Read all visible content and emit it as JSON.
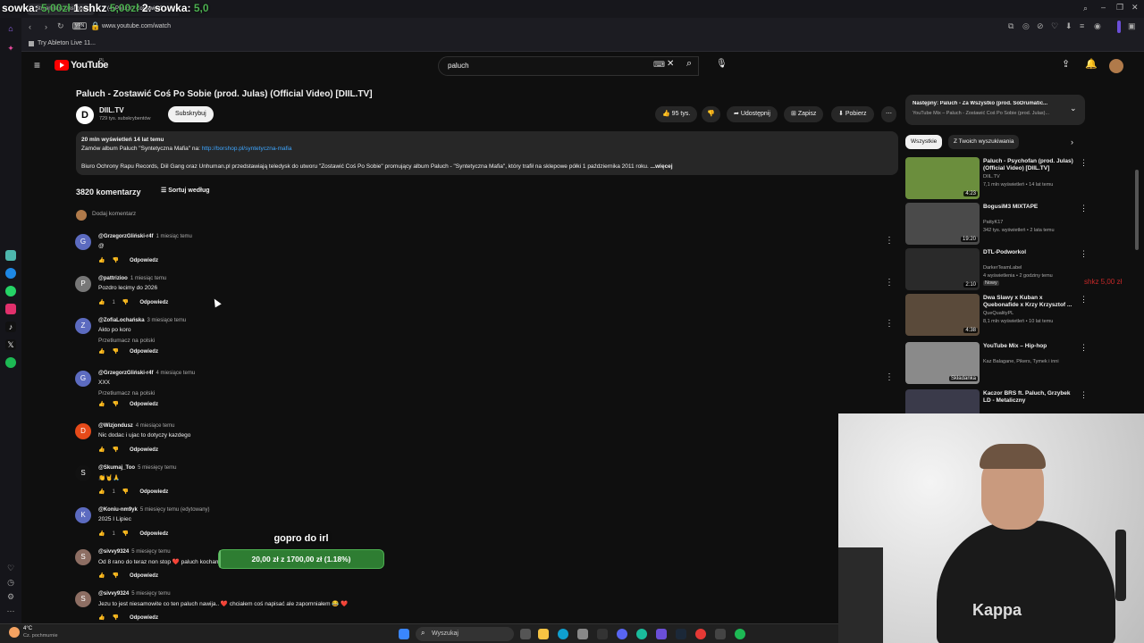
{
  "stream_overlay": {
    "top_text_a": "sowka:",
    "top_val_a": "5,00zł",
    "top_text_b": "1:shkz",
    "top_val_b": "5,00zł",
    "top_text_c": "2: sowka:",
    "top_val_c": "5,0",
    "side_text": "shkz 5,00 zł",
    "goal_title": "gopro do irl",
    "goal_progress": "20,00 zł z 1700,00 zł (1.18%)",
    "goal_fraction": 0.0118
  },
  "browser": {
    "tab_1": "Streamlabs Dashboard",
    "tab_2": "(4) Paluch - Zostawić C...",
    "vpn_badge": "VPN",
    "url": "www.youtube.com/watch",
    "bookmark": "Try Ableton Live 11..."
  },
  "yt": {
    "logo": "YouTube",
    "logo_region": "PL",
    "search_value": "paluch",
    "video_title": "Paluch - Zostawić Coś Po Sobie (prod. Julas) (Official Video) [DIIL.TV]",
    "channel_name": "DIIL.TV",
    "channel_subs": "729 tys. subskrybentów",
    "subscribe_label": "Subskrybuj",
    "likes": "95 tys.",
    "share_label": "Udostępnij",
    "save_label": "Zapisz",
    "download_label": "Pobierz",
    "desc_line1": "20 mln wyświetleń  14 lat temu",
    "desc_line2_prefix": "Zamów album Paluch \"Syntetyczna Mafia\" na: ",
    "desc_link": "http://borshop.pl/syntetyczna-mafia",
    "desc_line3": "Biuro Ochrony Rapu Records, Diil Gang oraz Unhuman.pl przedstawiają teledysk do utworu \"Zostawić Coś Po Sobie\" promujący album Paluch - \"Syntetyczna Mafia\", który trafił na sklepowe półki 1 października 2011 roku.",
    "desc_more": "...więcej",
    "comments_count": "3820 komentarzy",
    "sort_label": "Sortuj według",
    "add_comment": "Dodaj komentarz",
    "reply_label": "Odpowiedz",
    "translate_label": "Przetłumacz na polski",
    "comments": [
      {
        "author": "@GrzegorzGliński-r4f",
        "time": "1 miesiąc temu",
        "text": "@",
        "likes": "",
        "avatar": "G",
        "avatar_color": "#5c6bc0"
      },
      {
        "author": "@pattrizioo",
        "time": "1 miesiąc temu",
        "text": "Pozdro lecimy do 2026",
        "likes": "1",
        "avatar": "P",
        "avatar_color": "#777777"
      },
      {
        "author": "@ZofiaLochańska",
        "time": "3 miesiące temu",
        "text": "Akto po koro",
        "likes": "",
        "avatar": "Z",
        "avatar_color": "#5c6bc0"
      },
      {
        "author": "@GrzegorzGliński-r4f",
        "time": "4 miesiące temu",
        "text": "XXX",
        "likes": "",
        "avatar": "G",
        "avatar_color": "#5c6bc0"
      },
      {
        "author": "@Wizjondusz",
        "time": "4 miesiące temu",
        "text": "Nic dodac i ujac to dotyczy kazdego",
        "likes": "",
        "avatar": "D",
        "avatar_color": "#e64a19"
      },
      {
        "author": "@Skumaj_Too",
        "time": "5 miesięcy temu",
        "text": "👏🤘🙏",
        "likes": "1",
        "avatar": "S",
        "avatar_color": "#111111"
      },
      {
        "author": "@Koniu-nm9yk",
        "time": "5 miesięcy temu (edytowany)",
        "text": "2025 I Lipiec",
        "likes": "1",
        "avatar": "K",
        "avatar_color": "#5c6bc0"
      },
      {
        "author": "@sivvy9324",
        "time": "5 miesięcy temu",
        "text": "Od 8 rano do teraz non stop ❤️ paluch kocham",
        "likes": "",
        "avatar": "S",
        "avatar_color": "#8d6e63"
      },
      {
        "author": "@sivvy9324",
        "time": "5 miesięcy temu",
        "text": "Jezu to jest niesamowite co ten paluch nawija.. ❤️ chciałem coś napisać ale zapomniałem 😂 ❤️",
        "likes": "",
        "avatar": "S",
        "avatar_color": "#8d6e63"
      }
    ],
    "next_label": "Następny: Paluch - Za Wszystko (prod. SoDrumatic...",
    "next_sub": "YouTube Mix – Paluch - Zostawić Coś Po Sobie (prod. Julas)...",
    "chips": [
      "Wszystkie",
      "Z Twoich wyszukiwania"
    ],
    "recs": [
      {
        "title": "Paluch - Psychofan (prod. Julas) (Official Video) [DIIL.TV]",
        "channel": "DIIL.TV",
        "meta": "7,1 mln wyświetleń • 14 lat temu",
        "dur": "4:23",
        "color": "#6b8e3d",
        "badge": ""
      },
      {
        "title": "BogusiM3 MIXTAPE",
        "channel": "PattyK17",
        "meta": "342 tys. wyświetleń • 2 lata temu",
        "dur": "19:20",
        "color": "#4a4a4a",
        "badge": ""
      },
      {
        "title": "DTL-Podworkol",
        "channel": "DarkerTeamLabel",
        "meta": "4 wyświetlenia • 2 godziny temu",
        "dur": "2:10",
        "color": "#2a2a2a",
        "badge": "Nowy"
      },
      {
        "title": "Dwa Slawy x Kuban x Quebonafide x Krzy Krzysztof ...",
        "channel": "QueQualityPL",
        "meta": "8,1 mln wyświetleń • 10 lat temu",
        "dur": "4:38",
        "color": "#5a4a3a",
        "badge": ""
      },
      {
        "title": "YouTube Mix – Hip-hop",
        "channel": "Kaz Balagane, Pikers, Tymek i inni",
        "meta": "",
        "dur": "Składanka",
        "color": "#8a8a8a",
        "badge": ""
      },
      {
        "title": "Kaczor BRS ft. Paluch, Grzybek LD - Metaliczny",
        "channel": "",
        "meta": "",
        "dur": "",
        "color": "#3a3a4a",
        "badge": ""
      }
    ]
  },
  "taskbar": {
    "weather_temp": "4°C",
    "weather_text": "Cz. pochmurnie",
    "search_placeholder": "Wyszukaj"
  }
}
